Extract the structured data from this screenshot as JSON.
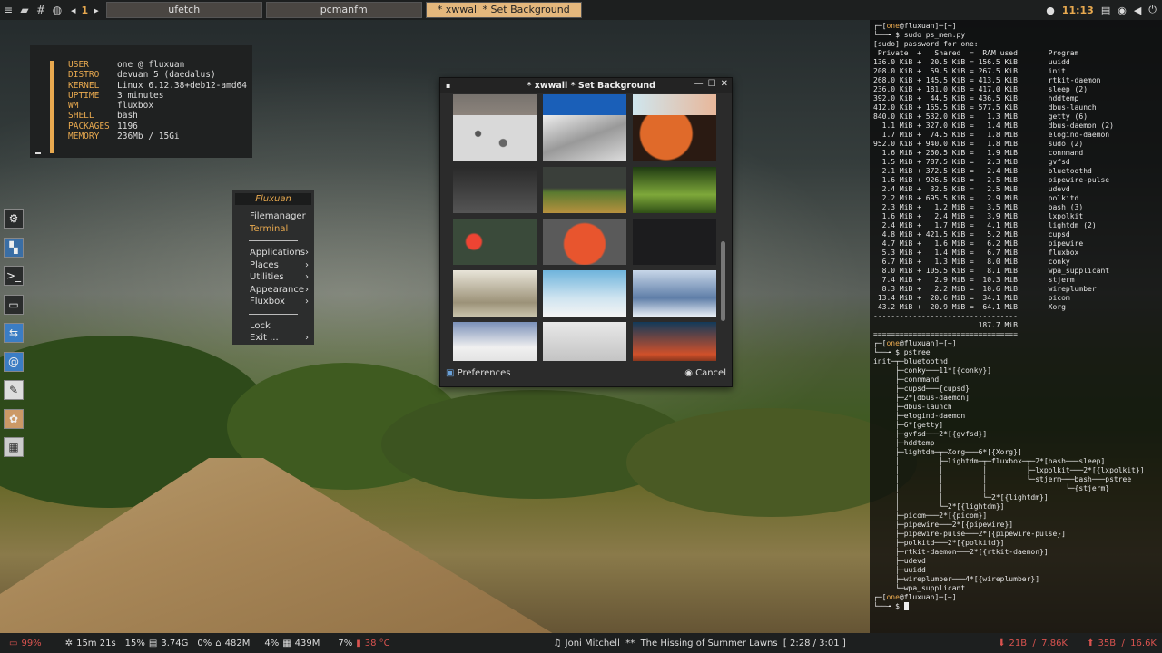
{
  "topbar": {
    "workspace_number": "1",
    "tasks": [
      "ufetch",
      "pcmanfm",
      "* xwwall *   Set Background"
    ],
    "clock": "11:13"
  },
  "fetch": {
    "rows": [
      {
        "k": "USER",
        "v": "one @ fluxuan"
      },
      {
        "k": "DISTRO",
        "v": "devuan 5 (daedalus)"
      },
      {
        "k": "KERNEL",
        "v": "Linux 6.12.38+deb12-amd64"
      },
      {
        "k": "UPTIME",
        "v": "3 minutes"
      },
      {
        "k": "WM",
        "v": "fluxbox"
      },
      {
        "k": "SHELL",
        "v": "bash"
      },
      {
        "k": "PACKAGES",
        "v": "1196"
      },
      {
        "k": "MEMORY",
        "v": "236Mb / 15Gi"
      }
    ]
  },
  "menu": {
    "title": "Fluxuan",
    "items_a": [
      "Filemanager",
      "Terminal"
    ],
    "items_b": [
      "Applications",
      "Places",
      "Utilities",
      "Appearance",
      "Fluxbox"
    ],
    "items_c": [
      "Lock",
      "Exit ..."
    ]
  },
  "window": {
    "title": "* xwwall *    Set Background",
    "preferences": "Preferences",
    "cancel": "Cancel"
  },
  "terminal": {
    "lines": [
      "┌─[one@fluxuan]─[~]",
      "└──╼ $ sudo ps_mem.py",
      "[sudo] password for one:",
      " Private  +   Shared  =  RAM used       Program",
      "",
      "136.0 KiB +  20.5 KiB = 156.5 KiB       uuidd",
      "208.0 KiB +  59.5 KiB = 267.5 KiB       init",
      "268.0 KiB + 145.5 KiB = 413.5 KiB       rtkit-daemon",
      "236.0 KiB + 181.0 KiB = 417.0 KiB       sleep (2)",
      "392.0 KiB +  44.5 KiB = 436.5 KiB       hddtemp",
      "412.0 KiB + 165.5 KiB = 577.5 KiB       dbus-launch",
      "840.0 KiB + 532.0 KiB =   1.3 MiB       getty (6)",
      "  1.1 MiB + 327.0 KiB =   1.4 MiB       dbus-daemon (2)",
      "  1.7 MiB +  74.5 KiB =   1.8 MiB       elogind-daemon",
      "952.0 KiB + 940.0 KiB =   1.8 MiB       sudo (2)",
      "  1.6 MiB + 260.5 KiB =   1.9 MiB       connmand",
      "  1.5 MiB + 787.5 KiB =   2.3 MiB       gvfsd",
      "  2.1 MiB + 372.5 KiB =   2.4 MiB       bluetoothd",
      "  1.6 MiB + 926.5 KiB =   2.5 MiB       pipewire-pulse",
      "  2.4 MiB +  32.5 KiB =   2.5 MiB       udevd",
      "  2.2 MiB + 695.5 KiB =   2.9 MiB       polkitd",
      "  2.3 MiB +   1.2 MiB =   3.5 MiB       bash (3)",
      "  1.6 MiB +   2.4 MiB =   3.9 MiB       lxpolkit",
      "  2.4 MiB +   1.7 MiB =   4.1 MiB       lightdm (2)",
      "  4.8 MiB + 421.5 KiB =   5.2 MiB       cupsd",
      "  4.7 MiB +   1.6 MiB =   6.2 MiB       pipewire",
      "  5.3 MiB +   1.4 MiB =   6.7 MiB       fluxbox",
      "  6.7 MiB +   1.3 MiB =   8.0 MiB       conky",
      "  8.0 MiB + 105.5 KiB =   8.1 MiB       wpa_supplicant",
      "  7.4 MiB +   2.9 MiB =  10.3 MiB       stjerm",
      "  8.3 MiB +   2.2 MiB =  10.6 MiB       wireplumber",
      " 13.4 MiB +  20.6 MiB =  34.1 MiB       picom",
      " 43.2 MiB +  20.9 MiB =  64.1 MiB       Xorg",
      "---------------------------------",
      "                        187.7 MiB",
      "=================================",
      "┌─[one@fluxuan]─[~]",
      "└──╼ $ pstree",
      "init─┬─bluetoothd",
      "     ├─conky───11*[{conky}]",
      "     ├─connmand",
      "     ├─cupsd───{cupsd}",
      "     ├─2*[dbus-daemon]",
      "     ├─dbus-launch",
      "     ├─elogind-daemon",
      "     ├─6*[getty]",
      "     ├─gvfsd───2*[{gvfsd}]",
      "     ├─hddtemp",
      "     ├─lightdm─┬─Xorg───6*[{Xorg}]",
      "     │         ├─lightdm─┬─fluxbox─┬─2*[bash───sleep]",
      "     │         │         │         ├─lxpolkit───2*[{lxpolkit}]",
      "     │         │         │         └─stjerm─┬─bash───pstree",
      "     │         │         │                  └─{stjerm}",
      "     │         │         └─2*[{lightdm}]",
      "     │         └─2*[{lightdm}]",
      "     ├─picom───2*[{picom}]",
      "     ├─pipewire───2*[{pipewire}]",
      "     ├─pipewire-pulse───2*[{pipewire-pulse}]",
      "     ├─polkitd───2*[{polkitd}]",
      "     ├─rtkit-daemon───2*[{rtkit-daemon}]",
      "     ├─udevd",
      "     ├─uuidd",
      "     ├─wireplumber───4*[{wireplumber}]",
      "     └─wpa_supplicant",
      "┌─[one@fluxuan]─[~]",
      "└──╼ $ "
    ]
  },
  "bottombar": {
    "battery": "99%",
    "uptime": "15m 21s",
    "cpu": "15%",
    "disk": "3.74G",
    "swap": "0%",
    "home": "482M",
    "mem_pct": "4%",
    "mem": "439M",
    "temp_pct": "7%",
    "temp": "38 °C",
    "now_playing": "Joni Mitchell  **  The Hissing of Summer Lawns  [ 2:28 / 3:01 ]",
    "down": "21B  /  7.86K",
    "up": "35B  /  16.6K"
  }
}
